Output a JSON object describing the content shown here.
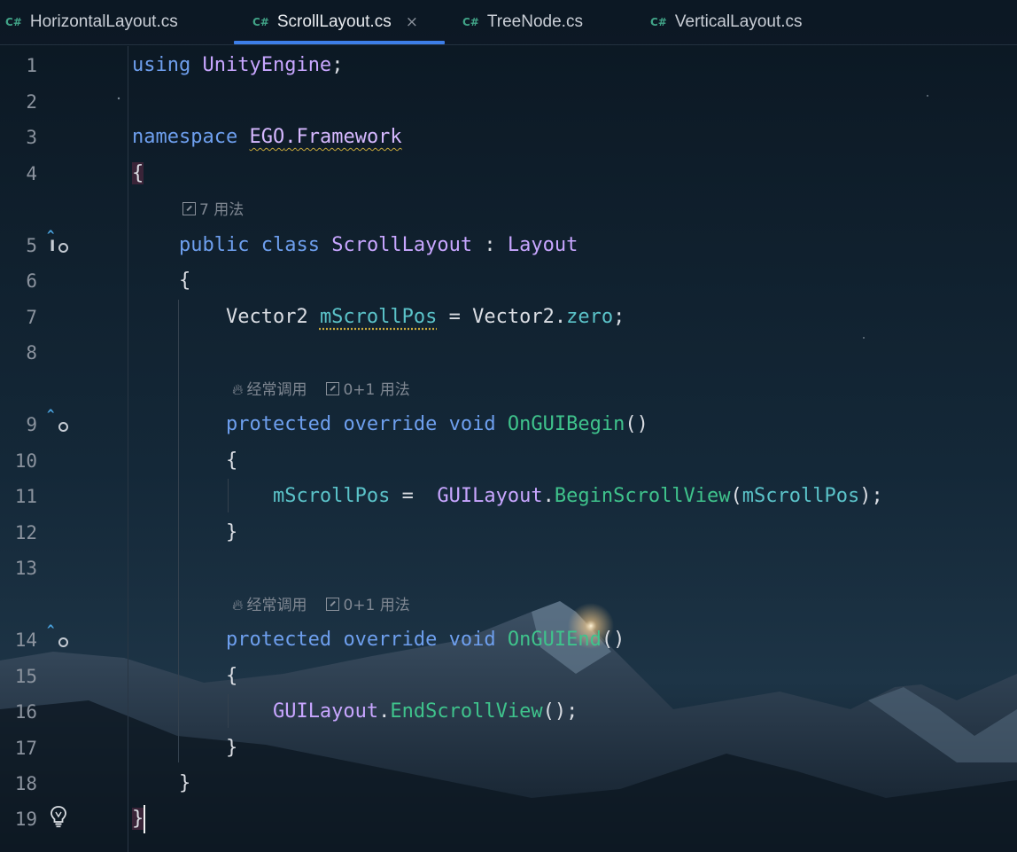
{
  "tabs": [
    {
      "icon": "C#",
      "label": "HorizontalLayout.cs",
      "active": false
    },
    {
      "icon": "C#",
      "label": "ScrollLayout.cs",
      "active": true,
      "close": "×"
    },
    {
      "icon": "C#",
      "label": "TreeNode.cs",
      "active": false
    },
    {
      "icon": "C#",
      "label": "VerticalLayout.cs",
      "active": false
    }
  ],
  "line_numbers": [
    "1",
    "2",
    "3",
    "4",
    "5",
    "6",
    "7",
    "8",
    "9",
    "10",
    "11",
    "12",
    "13",
    "14",
    "15",
    "16",
    "17",
    "18",
    "19"
  ],
  "code": {
    "l1": {
      "kw": "using",
      "ns": "UnityEngine",
      "end": ";"
    },
    "l3": {
      "kw": "namespace",
      "ns1": "EGO",
      "dot": ".",
      "ns2": "Framework"
    },
    "l4": {
      "brace": "{"
    },
    "l5": {
      "kw1": "public",
      "kw2": "class",
      "name": "ScrollLayout",
      "colon": " : ",
      "base": "Layout"
    },
    "l6": {
      "brace": "{"
    },
    "l7": {
      "type": "Vector2",
      "field": "mScrollPos",
      "eq": " = ",
      "type2": "Vector2",
      "dot": ".",
      "member": "zero",
      "end": ";"
    },
    "l9": {
      "kw1": "protected",
      "kw2": "override",
      "kw3": "void",
      "method": "OnGUIBegin",
      "paren": "()"
    },
    "l10": {
      "brace": "{"
    },
    "l11": {
      "field": "mScrollPos",
      "eq": " =  ",
      "cls": "GUILayout",
      "dot": ".",
      "method": "BeginScrollView",
      "open": "(",
      "arg": "mScrollPos",
      "close": ");"
    },
    "l12": {
      "brace": "}"
    },
    "l14": {
      "kw1": "protected",
      "kw2": "override",
      "kw3": "void",
      "method": "OnGUIEnd",
      "paren": "()"
    },
    "l15": {
      "brace": "{"
    },
    "l16": {
      "cls": "GUILayout",
      "dot": ".",
      "method": "EndScrollView",
      "end": "();"
    },
    "l17": {
      "brace": "}"
    },
    "l18": {
      "brace": "}"
    },
    "l19": {
      "brace": "}"
    }
  },
  "hints": {
    "class_usages": "7 用法",
    "frequent_call": "经常调用",
    "method_usages": "0+1 用法"
  },
  "colors": {
    "keyword": "#6e9fee",
    "type": "#c8a6ff",
    "field": "#5bc3c9",
    "method": "#3fc38c",
    "tab_accent": "#3d7ee8"
  },
  "gutter_icons": [
    "implements-icon",
    "override-icon",
    "override-icon",
    "lightbulb-icon"
  ]
}
